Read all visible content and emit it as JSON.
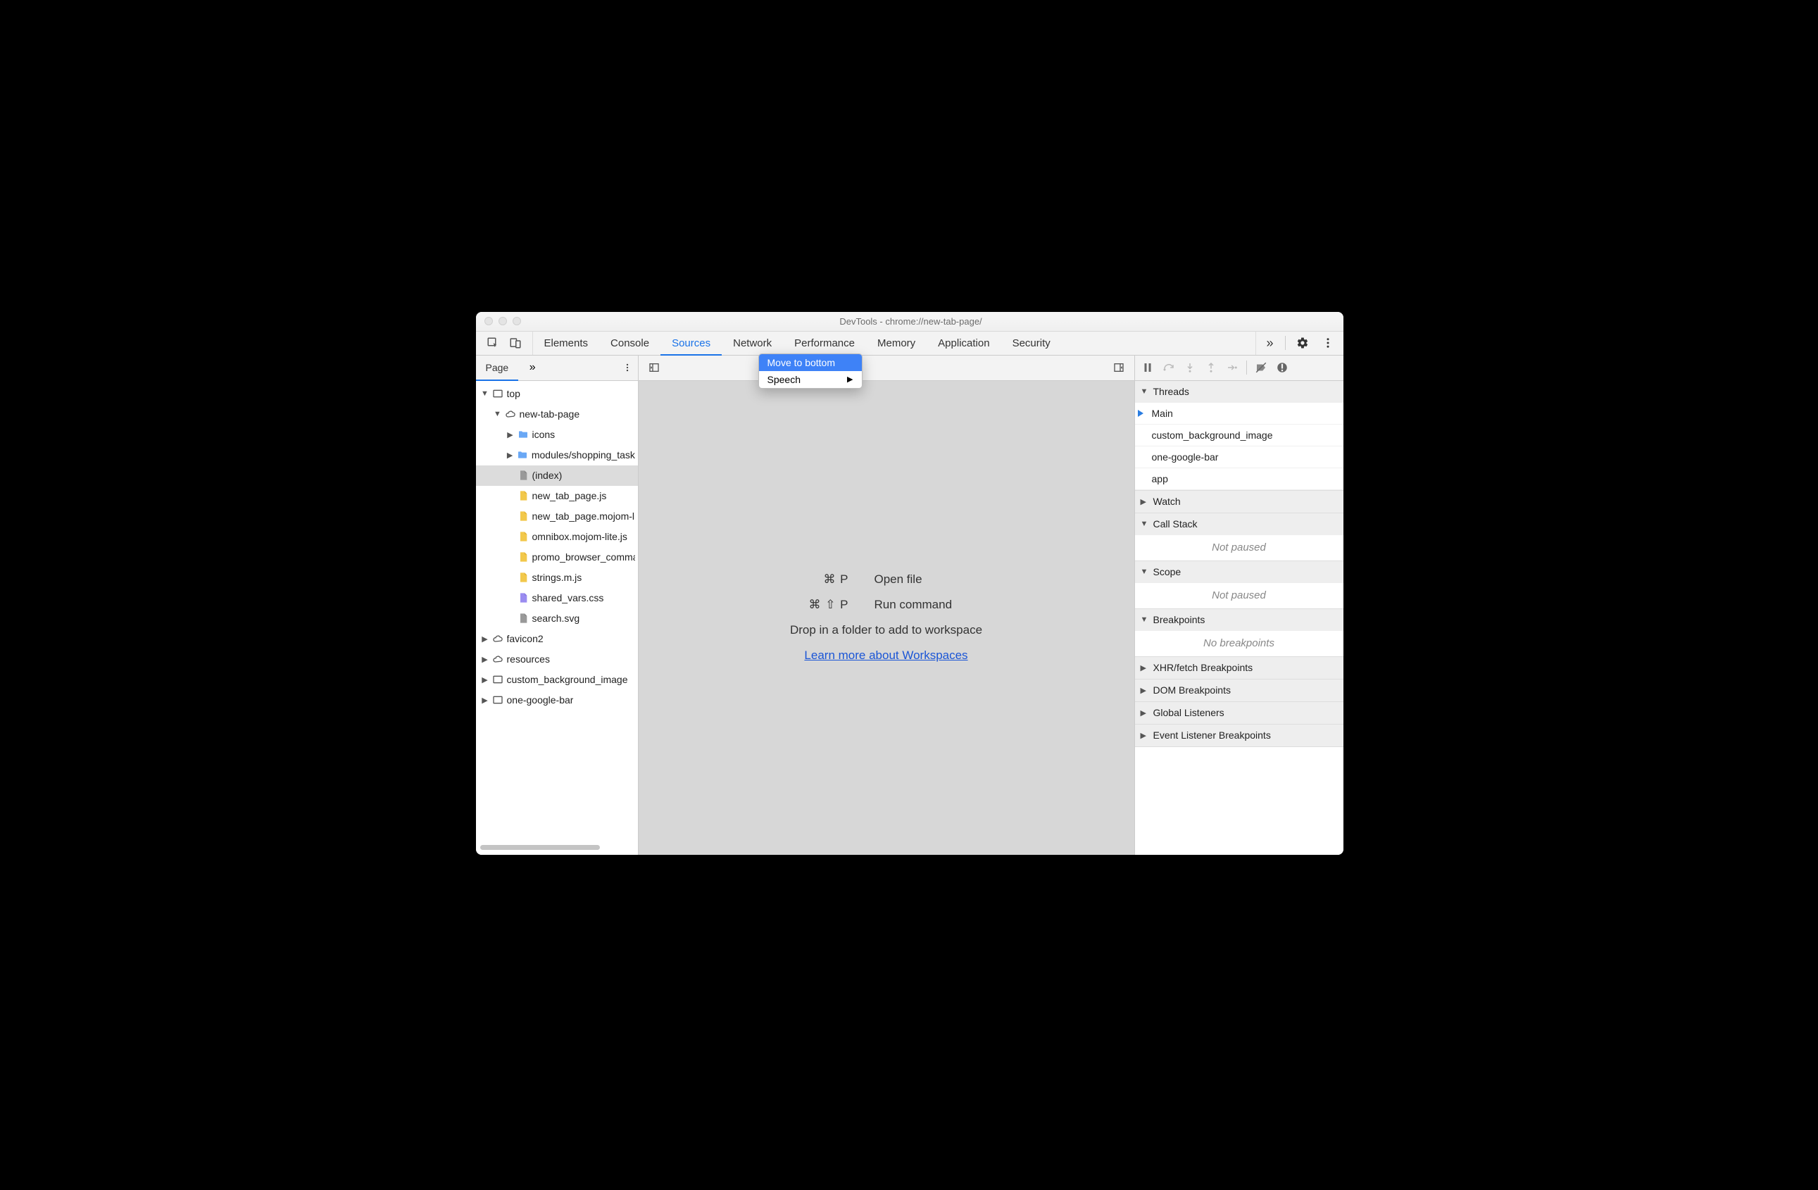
{
  "window": {
    "title": "DevTools - chrome://new-tab-page/"
  },
  "mainTabs": {
    "items": [
      "Elements",
      "Console",
      "Sources",
      "Network",
      "Performance",
      "Memory",
      "Application",
      "Security"
    ],
    "activeIndex": 2
  },
  "contextMenu": {
    "items": [
      {
        "label": "Move to bottom",
        "highlight": true,
        "submenu": false
      },
      {
        "label": "Speech",
        "highlight": false,
        "submenu": true
      }
    ]
  },
  "leftPane": {
    "tab": "Page",
    "tree": [
      {
        "depth": 0,
        "arrow": "▼",
        "icon": "frame",
        "label": "top"
      },
      {
        "depth": 1,
        "arrow": "▼",
        "icon": "cloud",
        "label": "new-tab-page"
      },
      {
        "depth": 2,
        "arrow": "▶",
        "icon": "folder",
        "label": "icons"
      },
      {
        "depth": 2,
        "arrow": "▶",
        "icon": "folder",
        "label": "modules/shopping_tasks"
      },
      {
        "depth": 2,
        "arrow": "",
        "icon": "doc",
        "label": "(index)",
        "selected": true
      },
      {
        "depth": 2,
        "arrow": "",
        "icon": "js",
        "label": "new_tab_page.js"
      },
      {
        "depth": 2,
        "arrow": "",
        "icon": "js",
        "label": "new_tab_page.mojom-lite.js"
      },
      {
        "depth": 2,
        "arrow": "",
        "icon": "js",
        "label": "omnibox.mojom-lite.js"
      },
      {
        "depth": 2,
        "arrow": "",
        "icon": "js",
        "label": "promo_browser_command.mojom-lite.js"
      },
      {
        "depth": 2,
        "arrow": "",
        "icon": "js",
        "label": "strings.m.js"
      },
      {
        "depth": 2,
        "arrow": "",
        "icon": "css",
        "label": "shared_vars.css"
      },
      {
        "depth": 2,
        "arrow": "",
        "icon": "doc",
        "label": "search.svg"
      },
      {
        "depth": 0,
        "arrow": "▶",
        "icon": "cloud",
        "label": "favicon2"
      },
      {
        "depth": 0,
        "arrow": "▶",
        "icon": "cloud",
        "label": "resources"
      },
      {
        "depth": 0,
        "arrow": "▶",
        "icon": "frame",
        "label": "custom_background_image"
      },
      {
        "depth": 0,
        "arrow": "▶",
        "icon": "frame",
        "label": "one-google-bar"
      }
    ]
  },
  "centerPane": {
    "row1": {
      "keys": "⌘ P",
      "label": "Open file"
    },
    "row2": {
      "keys": "⌘ ⇧ P",
      "label": "Run command"
    },
    "dropMsg": "Drop in a folder to add to workspace",
    "link": "Learn more about Workspaces"
  },
  "rightPane": {
    "threads": {
      "title": "Threads",
      "items": [
        "Main",
        "custom_background_image",
        "one-google-bar",
        "app"
      ],
      "activeIndex": 0
    },
    "watch": {
      "title": "Watch"
    },
    "callStack": {
      "title": "Call Stack",
      "placeholder": "Not paused"
    },
    "scope": {
      "title": "Scope",
      "placeholder": "Not paused"
    },
    "breakpoints": {
      "title": "Breakpoints",
      "placeholder": "No breakpoints"
    },
    "xhr": {
      "title": "XHR/fetch Breakpoints"
    },
    "dom": {
      "title": "DOM Breakpoints"
    },
    "global": {
      "title": "Global Listeners"
    },
    "event": {
      "title": "Event Listener Breakpoints"
    }
  }
}
